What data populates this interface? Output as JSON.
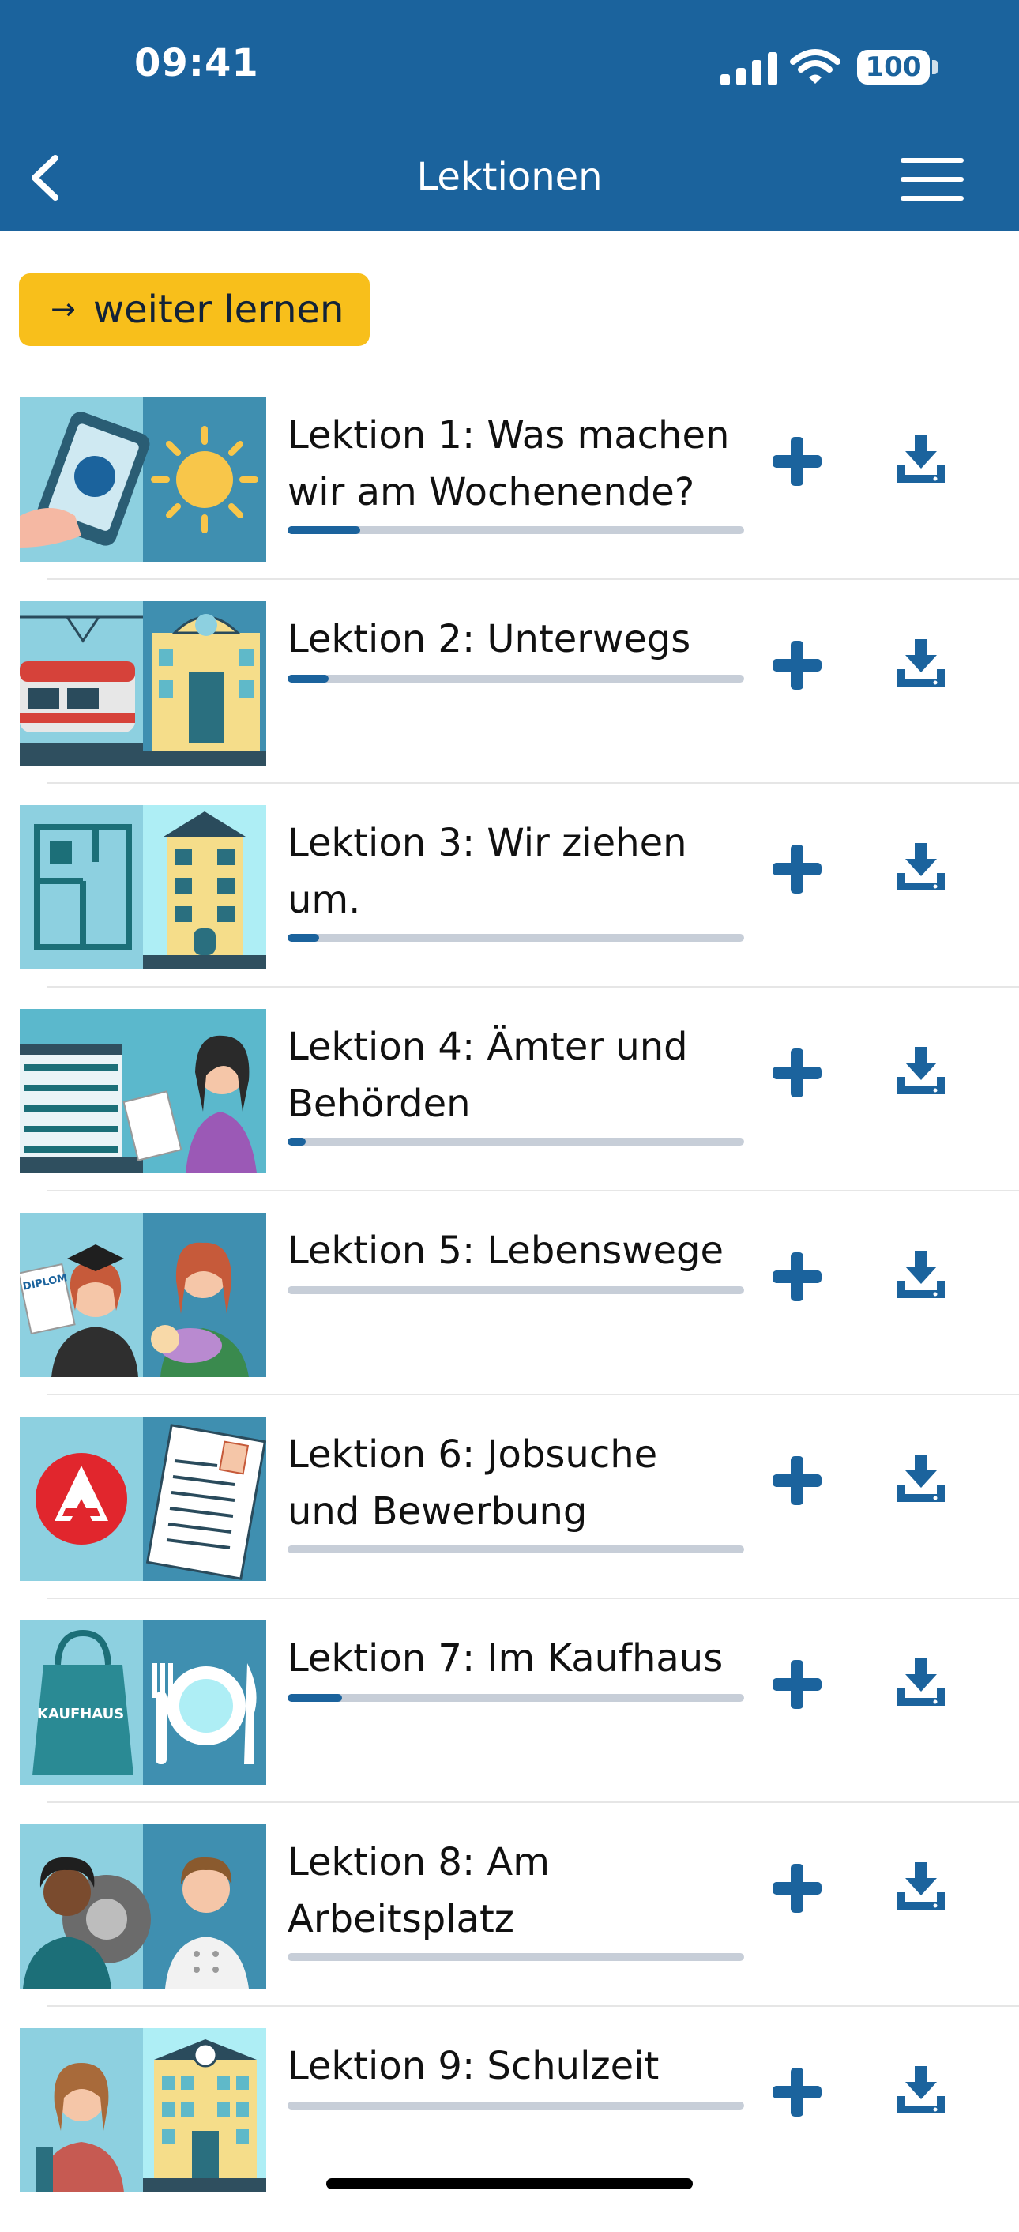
{
  "status_bar": {
    "time": "09:41",
    "battery": "100"
  },
  "header": {
    "title": "Lektionen"
  },
  "continue_button": {
    "arrow": "→",
    "label": "weiter lernen"
  },
  "lessons": [
    {
      "title": "Lektion 1: Was machen wir am Wochenende?",
      "progress": 0.16
    },
    {
      "title": "Lektion 2: Unterwegs",
      "progress": 0.09
    },
    {
      "title": "Lektion 3: Wir ziehen um.",
      "progress": 0.07
    },
    {
      "title": "Lektion 4: Ämter und Behörden",
      "progress": 0.04
    },
    {
      "title": "Lektion 5: Lebenswege",
      "progress": 0.0
    },
    {
      "title": "Lektion 6: Jobsuche und Bewerbung",
      "progress": 0.0
    },
    {
      "title": "Lektion 7: Im Kaufhaus",
      "progress": 0.12
    },
    {
      "title": "Lektion 8: Am Arbeitsplatz",
      "progress": 0.0
    },
    {
      "title": "Lektion 9: Schulzeit",
      "progress": 0.0
    }
  ],
  "thumb_labels": {
    "diplom": "DIPLOM",
    "kaufhaus": "KAUFHAUS"
  },
  "icons": [
    "back-chevron-icon",
    "hamburger-menu-icon",
    "plus-icon",
    "download-icon",
    "signal-icon",
    "wifi-icon",
    "battery-icon"
  ],
  "colors": {
    "primary": "#1b639d",
    "accent": "#f8bf1b",
    "progress_track": "#c7ced8"
  }
}
